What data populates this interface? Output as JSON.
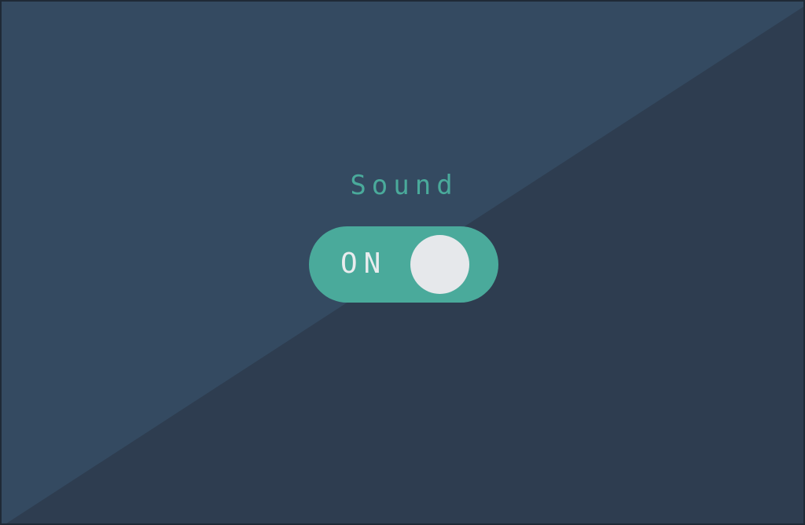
{
  "colors": {
    "background_light": "#344a61",
    "background_dark": "#2e3d50",
    "accent": "#4aaa9b",
    "knob": "#e6e8eb"
  },
  "setting": {
    "label": "Sound"
  },
  "toggle": {
    "state_text": "ON",
    "checked": true
  }
}
